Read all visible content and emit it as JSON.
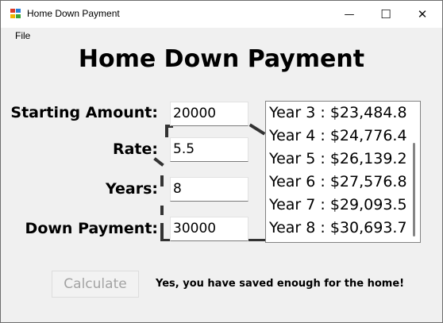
{
  "window": {
    "title": "Home Down Payment",
    "controls": {
      "minimize": "—",
      "maximize": "☐",
      "close": "✕"
    }
  },
  "menu": {
    "file": "File"
  },
  "heading": "Home Down Payment",
  "form": {
    "starting_amount": {
      "label": "Starting Amount:",
      "value": "20000"
    },
    "rate": {
      "label": "Rate:",
      "value": "5.5"
    },
    "years": {
      "label": "Years:",
      "value": "8"
    },
    "down_payment": {
      "label": "Down Payment:",
      "value": "30000"
    }
  },
  "results_list": [
    "Year 3 : $23,484.83",
    "Year 4 : $24,776.49",
    "Year 5 : $26,139.20",
    "Year 6 : $27,576.86",
    "Year 7 : $29,093.58",
    "Year 8 : $30,693.73"
  ],
  "calculate_button": "Calculate",
  "result_message": "Yes, you have saved enough for the home!",
  "colors": {
    "titlebar": "#ffffff",
    "background": "#f0f0f0",
    "disabled_text": "#a3a3a3"
  }
}
